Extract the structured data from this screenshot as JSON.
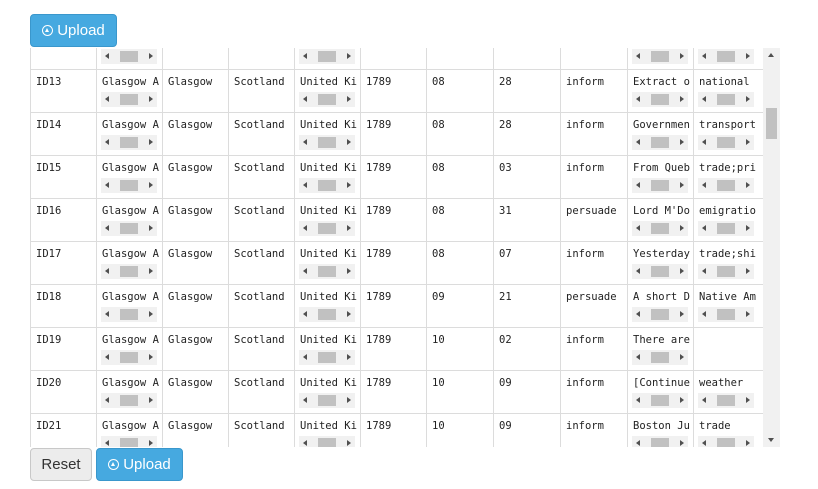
{
  "buttons": {
    "upload_top": "Upload",
    "upload_bottom": "Upload",
    "reset": "Reset"
  },
  "icons": {
    "upload": "circle-arrow-up-icon"
  },
  "colors": {
    "primary": "#46a9e0",
    "border": "#dcdcdc",
    "scrollbar_track": "#f1f1f1",
    "scrollbar_thumb": "#c1c1c1"
  },
  "table": {
    "partial_row_top": [
      "",
      "",
      "",
      "",
      "",
      "",
      "",
      "",
      "",
      "",
      ""
    ],
    "rows": [
      [
        "ID13",
        "Glasgow A",
        "Glasgow",
        "Scotland",
        "United Ki",
        "1789",
        "08",
        "28",
        "inform",
        "Extract o",
        "national"
      ],
      [
        "ID14",
        "Glasgow A",
        "Glasgow",
        "Scotland",
        "United Ki",
        "1789",
        "08",
        "28",
        "inform",
        "Governmen",
        "transport"
      ],
      [
        "ID15",
        "Glasgow A",
        "Glasgow",
        "Scotland",
        "United Ki",
        "1789",
        "08",
        "03",
        "inform",
        "From Queb",
        "trade;pri"
      ],
      [
        "ID16",
        "Glasgow A",
        "Glasgow",
        "Scotland",
        "United Ki",
        "1789",
        "08",
        "31",
        "persuade",
        "Lord M'Do",
        "emigratio"
      ],
      [
        "ID17",
        "Glasgow A",
        "Glasgow",
        "Scotland",
        "United Ki",
        "1789",
        "08",
        "07",
        "inform",
        "Yesterday",
        "trade;shi"
      ],
      [
        "ID18",
        "Glasgow A",
        "Glasgow",
        "Scotland",
        "United Ki",
        "1789",
        "09",
        "21",
        "persuade",
        "A short D",
        "Native Am"
      ],
      [
        "ID19",
        "Glasgow A",
        "Glasgow",
        "Scotland",
        "United Ki",
        "1789",
        "10",
        "02",
        "inform",
        "There are",
        ""
      ],
      [
        "ID20",
        "Glasgow A",
        "Glasgow",
        "Scotland",
        "United Ki",
        "1789",
        "10",
        "09",
        "inform",
        "[Continue",
        "weather"
      ],
      [
        "ID21",
        "Glasgow A",
        "Glasgow",
        "Scotland",
        "United Ki",
        "1789",
        "10",
        "09",
        "inform",
        "Boston Ju",
        "trade"
      ]
    ]
  }
}
